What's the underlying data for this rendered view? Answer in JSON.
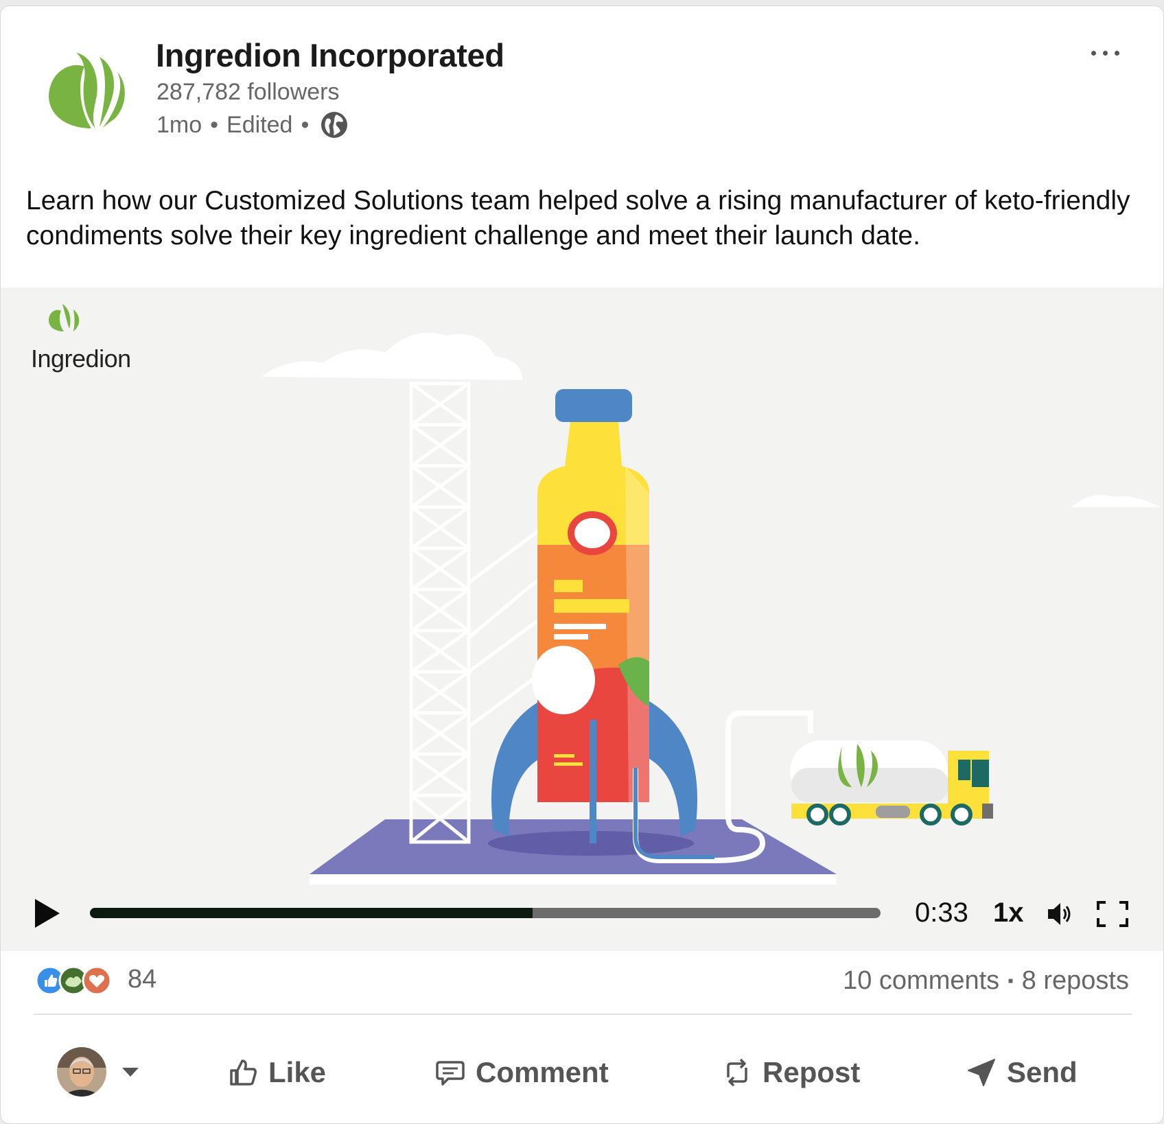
{
  "post": {
    "author": "Ingredion Incorporated",
    "followers": "287,782 followers",
    "age": "1mo",
    "edited": "Edited",
    "dot": "•",
    "visibility_icon": "globe-icon",
    "menu_icon": "more-options-icon",
    "text": "Learn how our Customized Solutions team helped solve a rising manufacturer of keto-friendly condiments solve their key ingredient challenge and meet their launch date."
  },
  "video": {
    "brand_watermark": "Ingredion",
    "time": "0:33",
    "speed": "1x",
    "progress": 0.56,
    "icons": [
      "play-icon",
      "volume-icon",
      "fullscreen-icon"
    ]
  },
  "stats": {
    "reaction_count": "84",
    "reaction_icons": [
      "like-reaction-icon",
      "celebrate-reaction-icon",
      "love-reaction-icon"
    ],
    "comments": "10 comments",
    "separator": "▪",
    "reposts": "8 reposts"
  },
  "actions": {
    "like": "Like",
    "comment": "Comment",
    "repost": "Repost",
    "send": "Send"
  },
  "colors": {
    "brand_green": "#79b443",
    "muted_text": "#666666",
    "progress_played": "#0c1a10",
    "progress_track": "#6c6c6c",
    "video_bg": "#f3f3f2"
  }
}
